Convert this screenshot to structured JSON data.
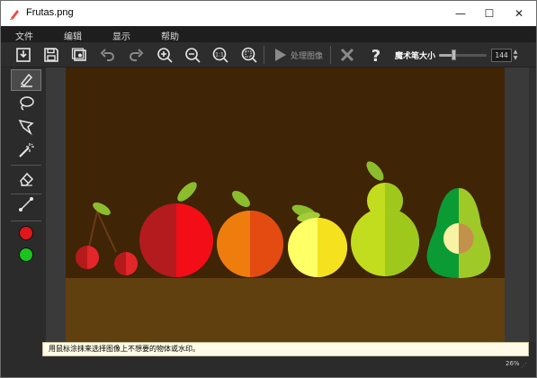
{
  "window": {
    "title": "Frutas.png",
    "min_glyph": "—",
    "max_glyph": "☐",
    "close_glyph": "✕"
  },
  "menu": [
    "文件",
    "编辑",
    "显示",
    "帮助"
  ],
  "toolbar": {
    "items": [
      "save-to-disk-icon",
      "save-icon",
      "copy-window-icon",
      "undo-icon",
      "redo-icon",
      "zoom-in-icon",
      "zoom-out-icon",
      "zoom-1-1-icon",
      "zoom-fit-icon",
      "play-icon",
      "cancel-icon",
      "help-icon"
    ],
    "process_label": "处理图像",
    "brush_size_label": "魔术笔大小",
    "brush_size_value": "144",
    "brush_size_fraction": 0.3
  },
  "sidebar": {
    "tools": [
      "marker-icon",
      "lasso-icon",
      "polygon-lasso-icon",
      "magic-wand-icon",
      "eraser-icon",
      "line-icon"
    ],
    "active_tool": "marker-icon",
    "colors": [
      "#e0161b",
      "#19c41c"
    ]
  },
  "status": {
    "hint": "用鼠标涂抹来选择图像上不想要的物体或水印。",
    "zoom": "26%"
  }
}
